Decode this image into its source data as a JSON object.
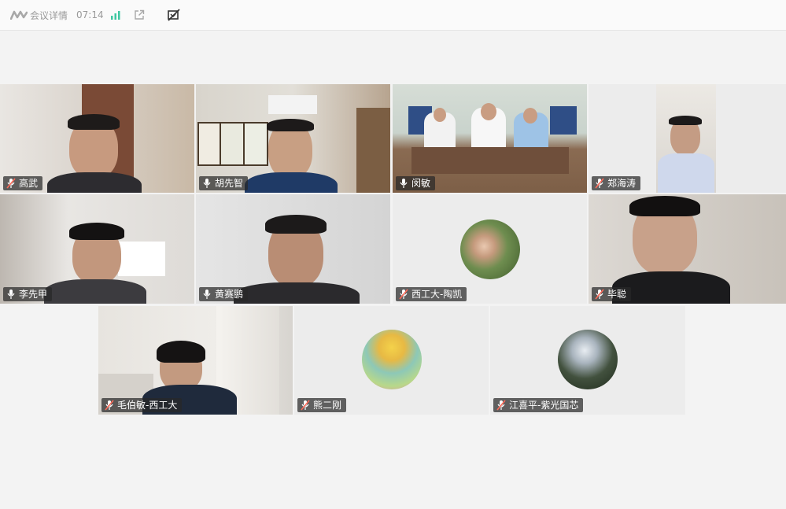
{
  "topbar": {
    "meeting_details": "会议详情",
    "timer": "07:14"
  },
  "participants": [
    {
      "name": "高武",
      "mic": "muted"
    },
    {
      "name": "胡先智",
      "mic": "on"
    },
    {
      "name": "闵敏",
      "mic": "on",
      "active_speaker": true
    },
    {
      "name": "郑海涛",
      "mic": "muted"
    },
    {
      "name": "李先甲",
      "mic": "on"
    },
    {
      "name": "黄赛鹏",
      "mic": "on"
    },
    {
      "name": "西工大-陶凯",
      "mic": "muted",
      "avatar": true
    },
    {
      "name": "毕聪",
      "mic": "muted"
    },
    {
      "name": "毛伯敏-西工大",
      "mic": "muted"
    },
    {
      "name": "熊二刚",
      "mic": "muted",
      "avatar": true
    },
    {
      "name": "江喜平-紫光国芯",
      "mic": "muted",
      "avatar": true
    }
  ],
  "colors": {
    "active_border": "#3fc7a1",
    "signal": "#3fc7a1",
    "muted_mic": "#ff6b5a"
  }
}
